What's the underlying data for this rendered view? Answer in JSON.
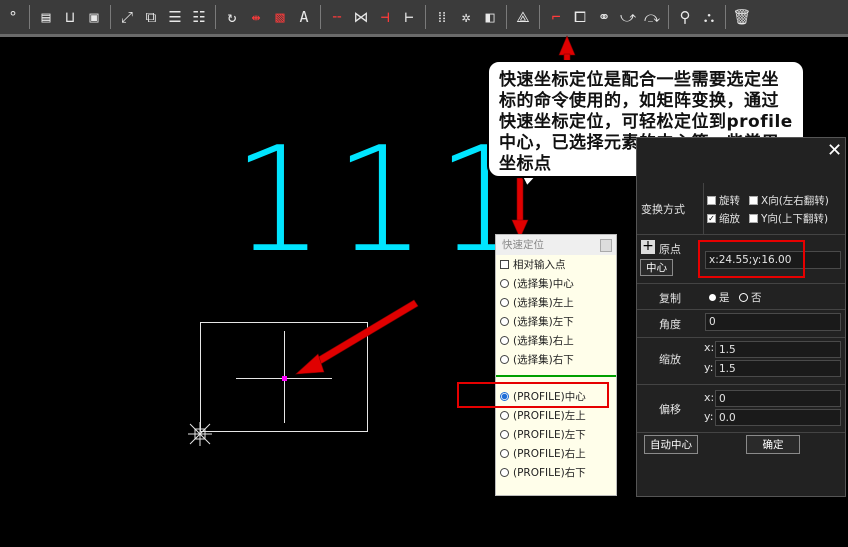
{
  "toolbar": {
    "icons": [
      "select-tool-icon",
      "edit-tool-icon",
      "save-icon",
      "frame-select-icon",
      "fit-icon",
      "zoom-in-icon",
      "split-h-icon",
      "split-v-icon",
      "rotate-icon",
      "mirror-icon",
      "delete-part-icon",
      "text-size-icon",
      "break-h-icon",
      "cross-icon",
      "cut-icon",
      "cut-right-icon",
      "array-icon",
      "scatter-icon",
      "layer-icon",
      "quick-coordinate-icon",
      "corner-icon",
      "copy-icon",
      "link-icon",
      "sequence-icon",
      "sequence2-icon",
      "tree-icon",
      "tree2-icon",
      "trash-icon"
    ]
  },
  "canvas": {
    "digits": [
      "1",
      "1",
      "1"
    ]
  },
  "callout": {
    "text": "快速坐标定位是配合一些需要选定坐标的命令使用的，如矩阵变换，通过快速坐标定位，可轻松定位到profile中心，已选择元素的中心等一些常用坐标点"
  },
  "quick_locate": {
    "title": "快速定位",
    "relative_input": "相对输入点",
    "options": [
      "(选择集)中心",
      "(选择集)左上",
      "(选择集)左下",
      "(选择集)右上",
      "(选择集)右下"
    ],
    "profile_options": [
      "(PROFILE)中心",
      "(PROFILE)左上",
      "(PROFILE)左下",
      "(PROFILE)右上",
      "(PROFILE)右下"
    ],
    "selected": "(PROFILE)中心"
  },
  "transform": {
    "close": "✕",
    "mode_label": "变换方式",
    "rotate": "旋转",
    "flip_x": "X向(左右翻转)",
    "scale": "缩放",
    "flip_y": "Y向(上下翻转)",
    "origin_label": "原点",
    "center_button": "中心",
    "origin_value": "x:24.55;y:16.00",
    "copy_label": "复制",
    "yes": "是",
    "no": "否",
    "angle_label": "角度",
    "angle_value": "0",
    "zoom_label": "缩放",
    "zoom_x_label": "x:",
    "zoom_x": "1.5",
    "zoom_y_label": "y:",
    "zoom_y": "1.5",
    "offset_label": "偏移",
    "offset_x_label": "x:",
    "offset_x": "0",
    "offset_y_label": "y:",
    "offset_y": "0.0",
    "auto_center_button": "自动中心",
    "confirm_button": "确定"
  }
}
